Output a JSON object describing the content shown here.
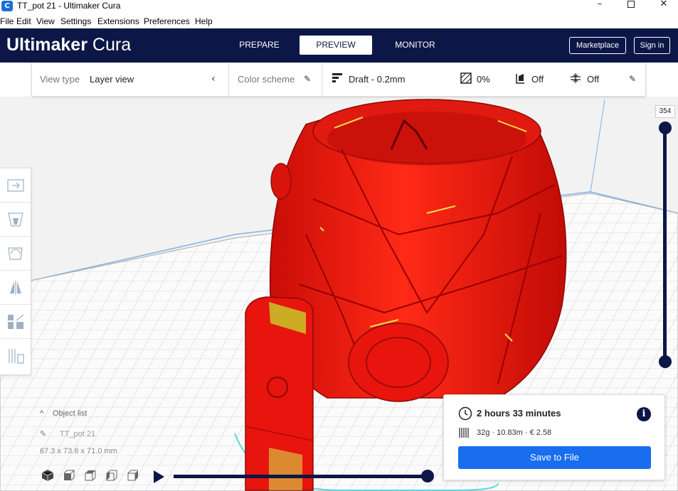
{
  "window": {
    "title": "TT_pot 21 - Ultimaker Cura",
    "app_icon": "C",
    "controls": {
      "minimize": "–",
      "close": "✕"
    }
  },
  "menu": [
    "File",
    "Edit",
    "View",
    "Settings",
    "Extensions",
    "Preferences",
    "Help"
  ],
  "header": {
    "logo_bold": "Ultimaker",
    "logo_regular": "Cura",
    "stages": [
      "PREPARE",
      "PREVIEW",
      "MONITOR"
    ],
    "active_stage": "PREVIEW",
    "marketplace_label": "Marketplace",
    "signin_label": "Sign in"
  },
  "toolbar": {
    "view_type_label": "View type",
    "view_type_value": "Layer view",
    "color_scheme_label": "Color scheme",
    "profile": "Draft - 0.2mm",
    "infill": "0%",
    "support": "Off",
    "adhesion": "Off"
  },
  "layer_slider": {
    "value": "354"
  },
  "object_list": {
    "label": "Object list",
    "object_name": "TT_pot 21",
    "dimensions": "67.3 x 73.6 x 71.0 mm"
  },
  "print_info": {
    "time": "2 hours 33 minutes",
    "material": "32g · 10.83m · € 2.58",
    "save_label": "Save to File",
    "info_glyph": "i"
  },
  "colors": {
    "header_bg": "#0c1747",
    "model_red": "#e8140e",
    "accent_blue": "#196ef0"
  }
}
